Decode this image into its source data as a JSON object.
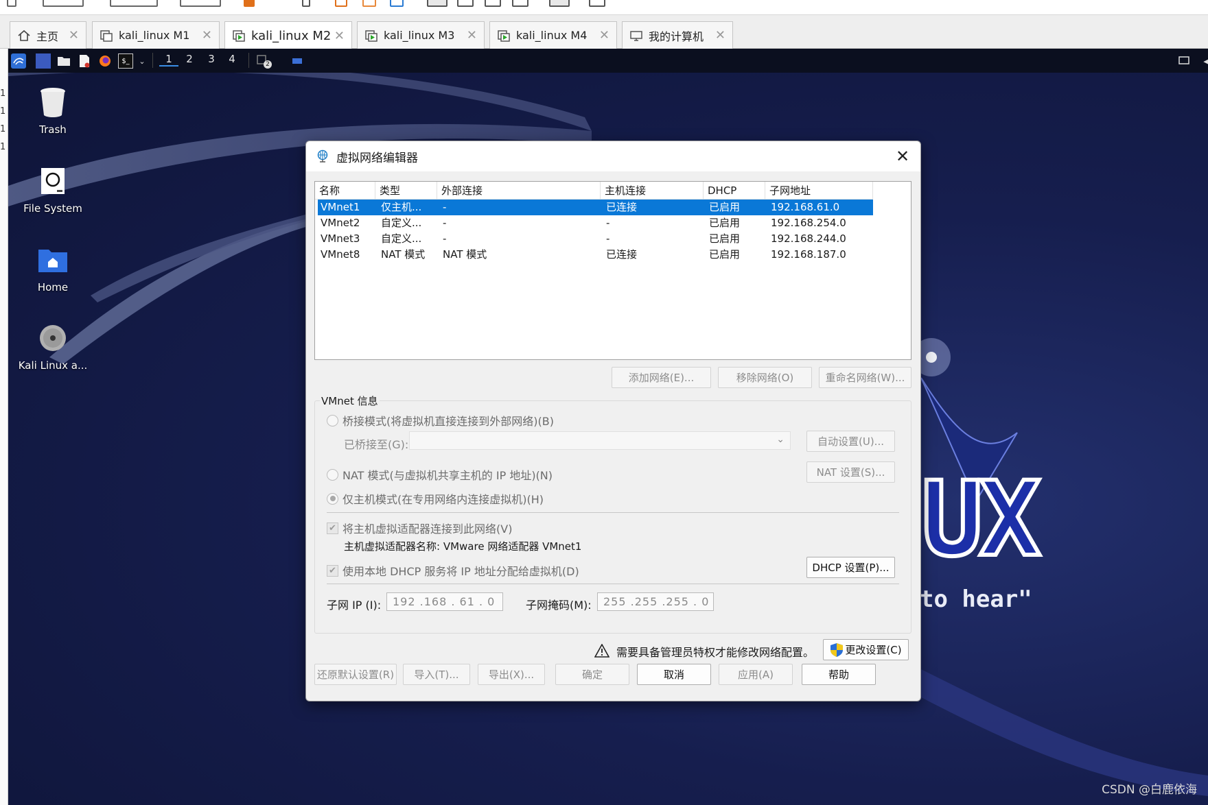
{
  "tabs": [
    {
      "label": "主页",
      "icon": "home-icon"
    },
    {
      "label": "kali_linux M1",
      "icon": "vm-icon"
    },
    {
      "label": "kali_linux M2",
      "icon": "vm-running-icon",
      "active": true
    },
    {
      "label": "kali_linux M3",
      "icon": "vm-running-icon"
    },
    {
      "label": "kali_linux M4",
      "icon": "vm-running-icon"
    },
    {
      "label": "我的计算机",
      "icon": "computer-icon"
    }
  ],
  "panel": {
    "workspaces": [
      "1",
      "2",
      "3",
      "4"
    ],
    "current_workspace": "1",
    "terminal_badge": "2"
  },
  "left_sliver": [
    "1",
    "1",
    "1",
    "1"
  ],
  "desktop": {
    "icons": [
      {
        "label": "Trash",
        "icon": "trash-icon"
      },
      {
        "label": "File System",
        "icon": "drive-icon"
      },
      {
        "label": "Home",
        "icon": "home-folder-icon"
      },
      {
        "label": "Kali Linux a...",
        "icon": "disc-icon"
      }
    ],
    "wallpaper_text_1": "UX",
    "wallpaper_text_2": "to hear\""
  },
  "dialog": {
    "title": "虚拟网络编辑器",
    "table": {
      "columns": [
        "名称",
        "类型",
        "外部连接",
        "主机连接",
        "DHCP",
        "子网地址"
      ],
      "rows": [
        [
          "VMnet1",
          "仅主机...",
          "-",
          "已连接",
          "已启用",
          "192.168.61.0"
        ],
        [
          "VMnet2",
          "自定义...",
          "-",
          "-",
          "已启用",
          "192.168.254.0"
        ],
        [
          "VMnet3",
          "自定义...",
          "-",
          "-",
          "已启用",
          "192.168.244.0"
        ],
        [
          "VMnet8",
          "NAT 模式",
          "NAT 模式",
          "已连接",
          "已启用",
          "192.168.187.0"
        ]
      ],
      "selected_row": 0
    },
    "net_buttons": {
      "add": "添加网络(E)...",
      "remove": "移除网络(O)",
      "rename": "重命名网络(W)..."
    },
    "vmnet_info": {
      "group_label": "VMnet 信息",
      "bridged_label": "桥接模式(将虚拟机直接连接到外部网络)(B)",
      "bridged_to_label": "已桥接至(G):",
      "bridged_to_value": "",
      "auto_settings": "自动设置(U)...",
      "nat_label": "NAT 模式(与虚拟机共享主机的 IP 地址)(N)",
      "nat_settings": "NAT 设置(S)...",
      "hostonly_label": "仅主机模式(在专用网络内连接虚拟机)(H)",
      "connect_adapter_label": "将主机虚拟适配器连接到此网络(V)",
      "adapter_name_label": "主机虚拟适配器名称: VMware 网络适配器 VMnet1",
      "dhcp_label": "使用本地 DHCP 服务将 IP 地址分配给虚拟机(D)",
      "dhcp_settings": "DHCP 设置(P)...",
      "subnet_ip_label": "子网 IP (I):",
      "subnet_ip_value": "192 .168 . 61  .  0",
      "subnet_mask_label": "子网掩码(M):",
      "subnet_mask_value": "255 .255 .255 .  0"
    },
    "admin_warning": "需要具备管理员特权才能修改网络配置。",
    "change_settings": "更改设置(C)",
    "footer_buttons": {
      "restore": "还原默认设置(R)",
      "import": "导入(T)...",
      "export": "导出(X)...",
      "ok": "确定",
      "cancel": "取消",
      "apply": "应用(A)",
      "help": "帮助"
    }
  },
  "watermark": "CSDN @白鹿依海",
  "colors": {
    "selection": "#0a78d7",
    "desktop_bg": "#161e4e",
    "panel_bg": "#0b0f1f"
  }
}
